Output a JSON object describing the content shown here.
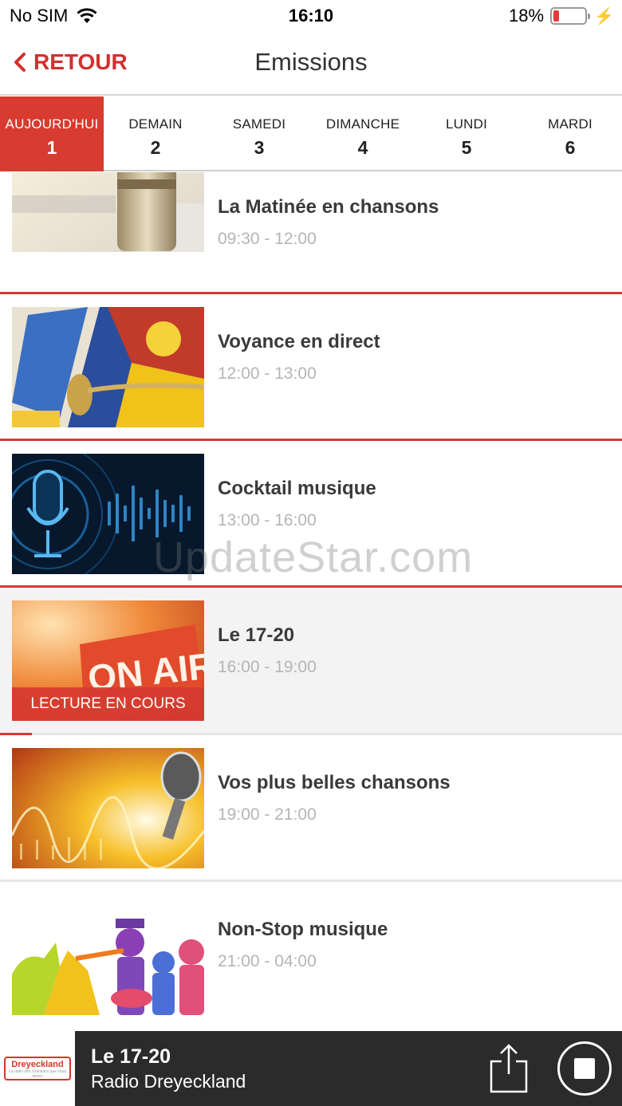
{
  "status_bar": {
    "carrier": "No SIM",
    "time": "16:10",
    "battery": "18%",
    "battery_level": 0.18,
    "icons": [
      "wifi-icon",
      "battery-icon",
      "charging-bolt-icon"
    ]
  },
  "nav": {
    "back_label": "RETOUR",
    "title": "Emissions"
  },
  "tabs": [
    {
      "label": "AUJOURD'HUI",
      "num": "1",
      "active": true
    },
    {
      "label": "DEMAIN",
      "num": "2"
    },
    {
      "label": "SAMEDI",
      "num": "3"
    },
    {
      "label": "DIMANCHE",
      "num": "4"
    },
    {
      "label": "LUNDI",
      "num": "5"
    },
    {
      "label": "MARDI",
      "num": "6"
    }
  ],
  "programs": [
    {
      "title": "La Matinée en chansons",
      "time": "09:30 - 12:00"
    },
    {
      "title": "Voyance en direct",
      "time": "12:00 - 13:00"
    },
    {
      "title": "Cocktail musique",
      "time": "13:00 - 16:00"
    },
    {
      "title": "Le 17-20",
      "time": "16:00 - 19:00",
      "badge": "LECTURE EN COURS",
      "current": true
    },
    {
      "title": "Vos plus belles chansons",
      "time": "19:00 - 21:00"
    },
    {
      "title": "Non-Stop musique",
      "time": "21:00 - 04:00"
    }
  ],
  "thumb_texts": {
    "on_air": "ON AIR"
  },
  "watermark": "UpdateStar.com",
  "player": {
    "logo_text": "Dreyeckland",
    "logo_tagline": "La radio des chansons que vous aimez",
    "title": "Le 17-20",
    "station": "Radio Dreyeckland"
  },
  "colors": {
    "accent": "#d83b30",
    "player_bg": "#2b2b2b",
    "time_text": "#b5b5b5"
  }
}
